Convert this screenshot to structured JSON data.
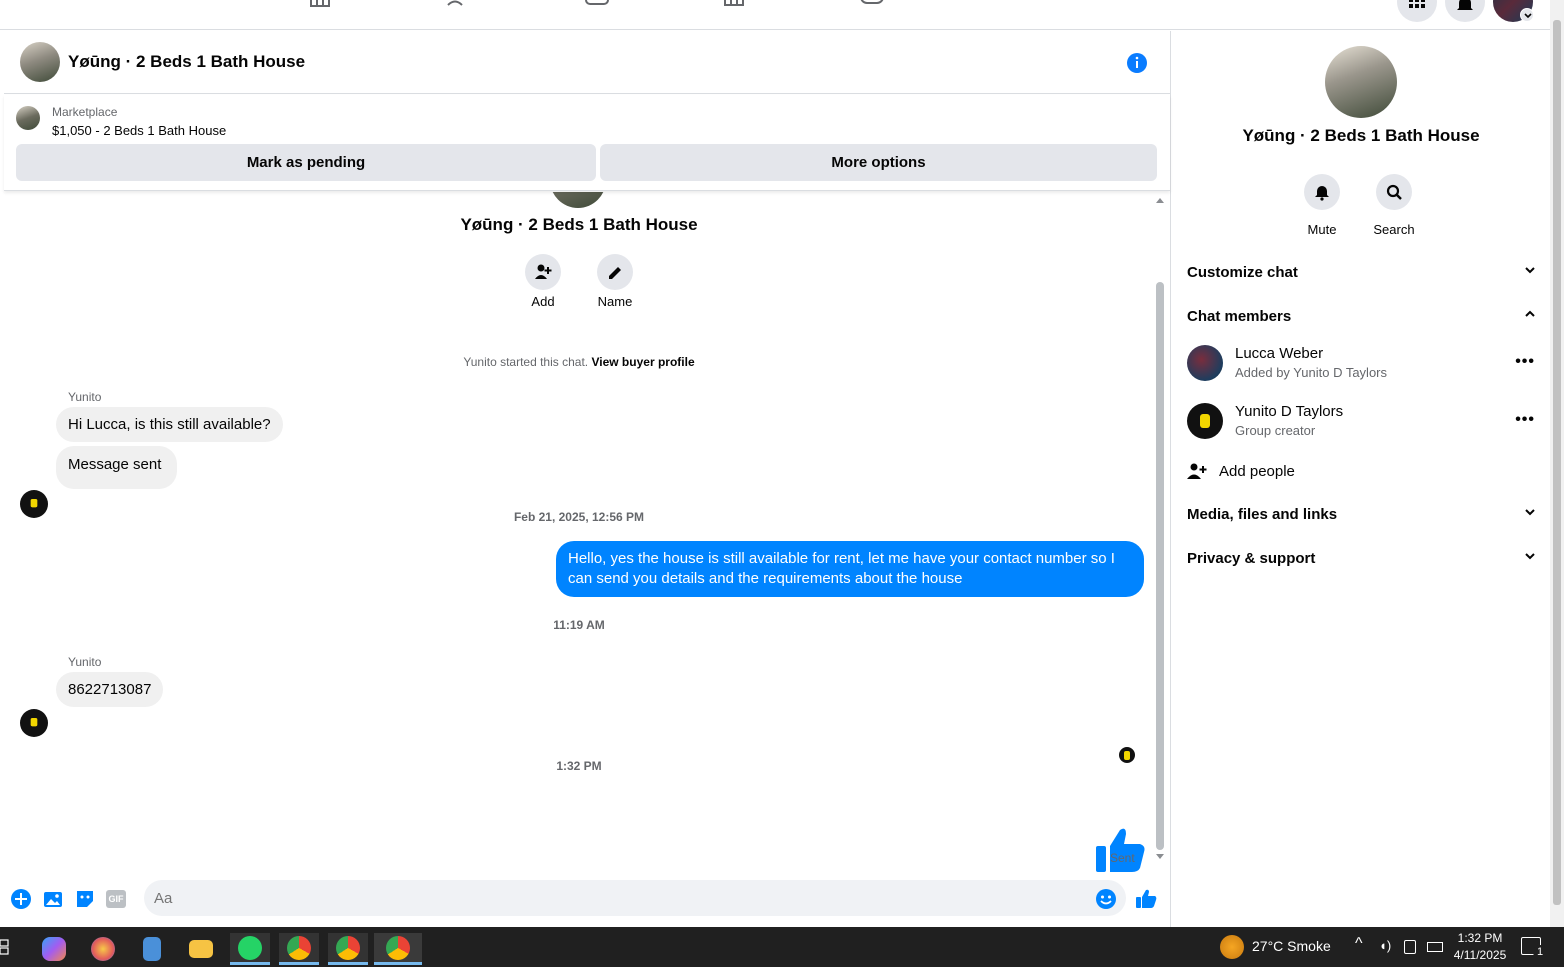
{
  "chat": {
    "title": "Yøūng · 2 Beds 1 Bath House",
    "marketplace": {
      "kicker": "Marketplace",
      "listing": "$1,050 - 2 Beds 1 Bath House",
      "pending_label": "Mark as pending",
      "more_label": "More options"
    },
    "thread": {
      "group_title": "Yøūng · 2 Beds 1 Bath House",
      "add_label": "Add",
      "name_label": "Name",
      "started_text": "Yunito started this chat.",
      "buyer_profile_link": "View buyer profile",
      "messages": [
        {
          "sender": "Yunito",
          "text": "Hi Lucca, is this still available?"
        },
        {
          "text": "Message sent"
        },
        {
          "timestamp": "Feb 21, 2025, 12:56 PM"
        },
        {
          "text": "Hello, yes the house is still available for rent, let me have your contact number so I can send you details and the requirements about the house"
        },
        {
          "timestamp": "11:19 AM"
        },
        {
          "sender": "Yunito",
          "text": "8622713087"
        },
        {
          "timestamp": "1:32 PM"
        }
      ],
      "sent_label": "Sent"
    },
    "composer": {
      "placeholder": "Aa",
      "gif_label": "GIF"
    }
  },
  "sidebar": {
    "title": "Yøūng · 2 Beds 1 Bath House",
    "mute_label": "Mute",
    "search_label": "Search",
    "sections": {
      "customize": "Customize chat",
      "members": "Chat members",
      "media": "Media, files and links",
      "privacy": "Privacy & support"
    },
    "members": [
      {
        "name": "Lucca Weber",
        "sub": "Added by Yunito D Taylors"
      },
      {
        "name": "Yunito D Taylors",
        "sub": "Group creator"
      }
    ],
    "add_people": "Add people"
  },
  "taskbar": {
    "weather": "27°C  Smoke",
    "time": "1:32 PM",
    "date": "4/11/2025",
    "notification_count": "1"
  },
  "colors": {
    "accent": "#0084ff",
    "bubble_in": "#f0f0f0",
    "button_gray": "#e4e6eb"
  }
}
